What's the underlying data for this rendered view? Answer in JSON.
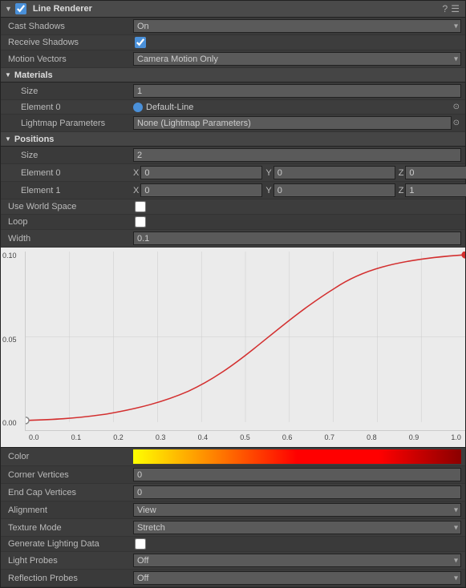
{
  "header": {
    "title": "Line Renderer",
    "icon_check": "✓"
  },
  "rows": {
    "cast_shadows": {
      "label": "Cast Shadows",
      "value": "On"
    },
    "receive_shadows": {
      "label": "Receive Shadows"
    },
    "motion_vectors": {
      "label": "Motion Vectors",
      "value": "Camera Motion Only"
    },
    "materials_section": {
      "label": "Materials"
    },
    "mat_size": {
      "label": "Size",
      "value": "1"
    },
    "mat_element0": {
      "label": "Element 0",
      "value": "Default-Line"
    },
    "lightmap_params": {
      "label": "Lightmap Parameters",
      "value": "None (Lightmap Parameters)"
    },
    "positions_section": {
      "label": "Positions"
    },
    "pos_size": {
      "label": "Size",
      "value": "2"
    },
    "pos_element0": {
      "label": "Element 0",
      "x": "0",
      "y": "0",
      "z": "0"
    },
    "pos_element1": {
      "label": "Element 1",
      "x": "0",
      "y": "0",
      "z": "1"
    },
    "use_world_space": {
      "label": "Use World Space"
    },
    "loop": {
      "label": "Loop"
    },
    "width": {
      "label": "Width",
      "value": "0.1"
    },
    "color": {
      "label": "Color"
    },
    "corner_vertices": {
      "label": "Corner Vertices",
      "value": "0"
    },
    "end_cap_vertices": {
      "label": "End Cap Vertices",
      "value": "0"
    },
    "alignment": {
      "label": "Alignment",
      "value": "View"
    },
    "texture_mode": {
      "label": "Texture Mode",
      "value": "Stretch"
    },
    "generate_lighting": {
      "label": "Generate Lighting Data"
    },
    "light_probes": {
      "label": "Light Probes",
      "value": "Off"
    },
    "reflection_probes": {
      "label": "Reflection Probes",
      "value": "Off"
    }
  },
  "curve": {
    "y_labels": [
      "0.10",
      "0.05",
      "0.00"
    ],
    "x_labels": [
      "0.0",
      "0.1",
      "0.2",
      "0.3",
      "0.4",
      "0.5",
      "0.6",
      "0.7",
      "0.8",
      "0.9",
      "1.0"
    ]
  }
}
